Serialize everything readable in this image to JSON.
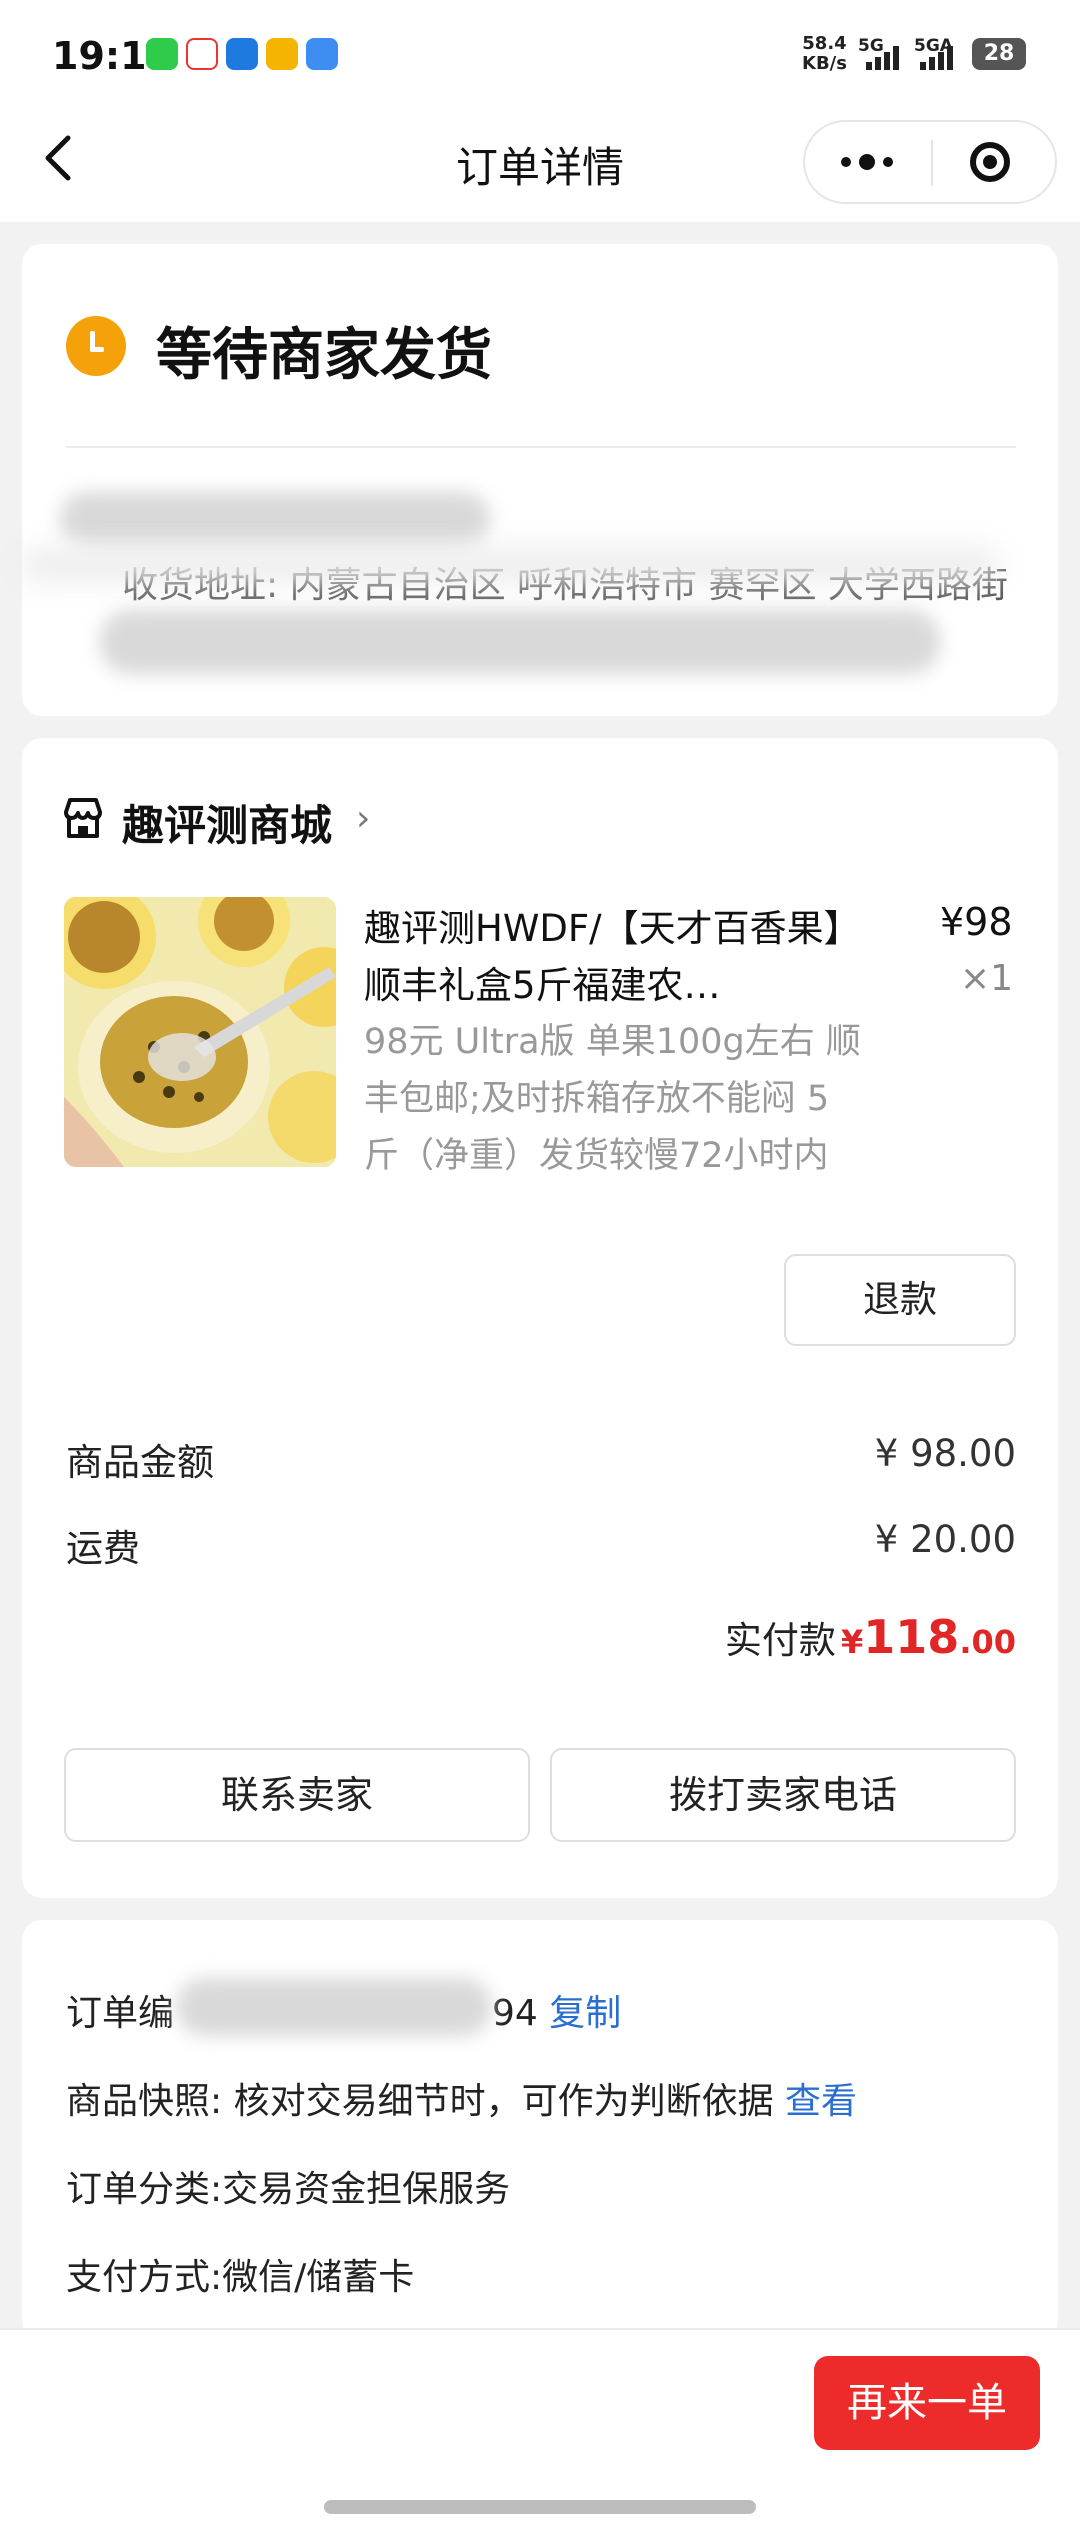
{
  "status_bar": {
    "time": "19:11",
    "net_speed_value": "58.4",
    "net_speed_unit": "KB/s",
    "signal_1": "5G",
    "signal_2": "5GA",
    "battery": "28"
  },
  "header": {
    "title": "订单详情"
  },
  "order_status": {
    "text": "等待商家发货",
    "address_visible": "收货地址: 内蒙古自治区 呼和浩特市 赛罕区 大学西路街"
  },
  "shop": {
    "name": "趣评测商城"
  },
  "product": {
    "title": "趣评测HWDF/【天才百香果】顺丰礼盒5斤福建农…",
    "spec": "98元 Ultra版 单果100g左右 顺丰包邮;及时拆箱存放不能闷 5斤（净重）发货较慢72小时内",
    "price": "¥98",
    "quantity": "×1",
    "refund_label": "退款"
  },
  "amounts": {
    "goods_label": "商品金额",
    "goods_value": "¥ 98.00",
    "shipping_label": "运费",
    "shipping_value": "¥ 20.00",
    "paid_label": "实付款",
    "paid_currency": "¥",
    "paid_integer": "118",
    "paid_decimal": ".00"
  },
  "actions": {
    "contact": "联系卖家",
    "call": "拨打卖家电话"
  },
  "order_info": {
    "number_label": "订单编",
    "number_tail": "94",
    "copy": "复制",
    "snapshot_text": "商品快照: 核对交易细节时，可作为判断依据",
    "snapshot_link": "查看",
    "category": "订单分类:交易资金担保服务",
    "payment": "支付方式:微信/储蓄卡"
  },
  "bottom": {
    "reorder": "再来一单"
  },
  "colors": {
    "accent_red": "#ee2b2b",
    "status_orange": "#f5a20a",
    "link_blue": "#2a6fd0"
  }
}
